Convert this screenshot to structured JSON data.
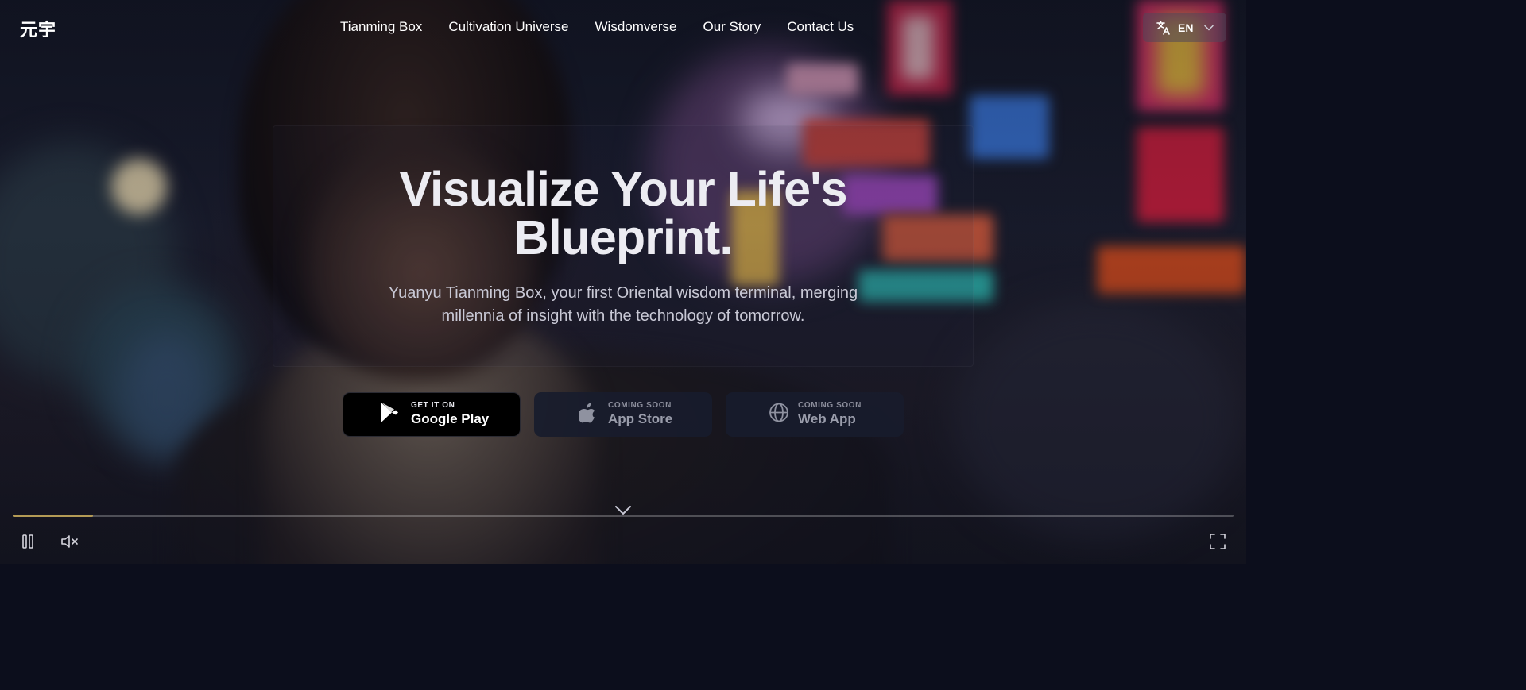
{
  "brand": {
    "logo": "元宇"
  },
  "nav": {
    "items": [
      {
        "label": "Tianming Box"
      },
      {
        "label": "Cultivation Universe"
      },
      {
        "label": "Wisdomverse"
      },
      {
        "label": "Our Story"
      },
      {
        "label": "Contact Us"
      }
    ]
  },
  "language": {
    "label": "EN",
    "icon": "translate-icon"
  },
  "hero": {
    "title_line1": "Visualize Your Life's",
    "title_line2": "Blueprint.",
    "subtitle_line1": "Yuanyu Tianming Box, your first Oriental wisdom terminal, merging",
    "subtitle_line2": "millennia of insight with the technology of tomorrow."
  },
  "stores": {
    "google": {
      "small": "GET IT ON",
      "big": "Google Play",
      "icon": "google-play-icon"
    },
    "apple": {
      "small": "COMING SOON",
      "big": "App Store",
      "icon": "apple-icon"
    },
    "web": {
      "small": "COMING SOON",
      "big": "Web App",
      "icon": "globe-icon"
    }
  },
  "video": {
    "progress": 0.066,
    "progress_color": "#b39a55",
    "controls": [
      "pause-icon",
      "mute-icon",
      "fullscreen-icon"
    ]
  },
  "colors": {
    "accent": "#b39a55",
    "google_button_bg": "#000000",
    "disabled_button_bg": "#181c2c"
  }
}
